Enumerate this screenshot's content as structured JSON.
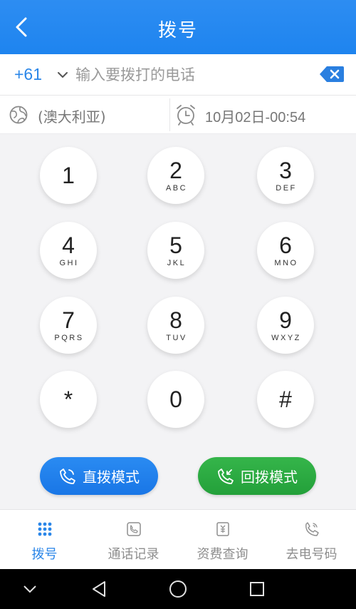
{
  "header": {
    "title": "拨号"
  },
  "input": {
    "country_code": "+61",
    "placeholder": "输入要拨打的电话",
    "value": ""
  },
  "info": {
    "region": "(澳大利亚)",
    "time": "10月02日-00:54"
  },
  "keypad": {
    "keys": [
      {
        "digit": "1",
        "letters": ""
      },
      {
        "digit": "2",
        "letters": "ABC"
      },
      {
        "digit": "3",
        "letters": "DEF"
      },
      {
        "digit": "4",
        "letters": "GHI"
      },
      {
        "digit": "5",
        "letters": "JKL"
      },
      {
        "digit": "6",
        "letters": "MNO"
      },
      {
        "digit": "7",
        "letters": "PQRS"
      },
      {
        "digit": "8",
        "letters": "TUV"
      },
      {
        "digit": "9",
        "letters": "WXYZ"
      },
      {
        "digit": "*",
        "letters": ""
      },
      {
        "digit": "0",
        "letters": ""
      },
      {
        "digit": "#",
        "letters": ""
      }
    ]
  },
  "actions": {
    "direct": "直拨模式",
    "callback": "回拨模式"
  },
  "tabs": [
    {
      "label": "拨号",
      "icon": "dialpad-icon",
      "active": true
    },
    {
      "label": "通话记录",
      "icon": "call-log-icon",
      "active": false
    },
    {
      "label": "资费查询",
      "icon": "rates-icon",
      "active": false
    },
    {
      "label": "去电号码",
      "icon": "caller-id-icon",
      "active": false
    }
  ],
  "colors": {
    "primary": "#1e84ef",
    "accent_green": "#2aa83f",
    "inactive": "#8e8e8e"
  }
}
